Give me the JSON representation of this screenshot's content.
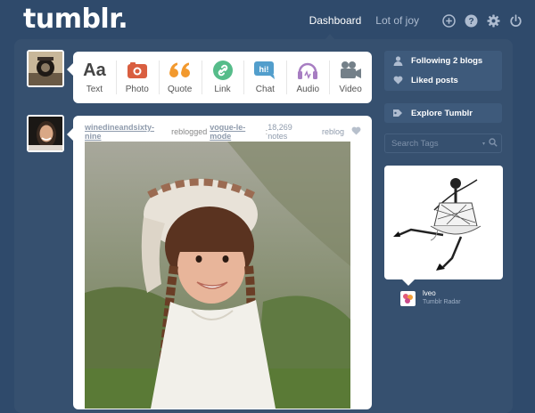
{
  "header": {
    "logo": "tumblr.",
    "nav": {
      "dashboard": "Dashboard",
      "blog": "Lot of joy"
    },
    "icons": [
      "plus-circle-icon",
      "help-icon",
      "gear-icon",
      "power-icon"
    ]
  },
  "post_types": [
    {
      "label": "Text",
      "icon": "text-icon",
      "color": "#444444"
    },
    {
      "label": "Photo",
      "icon": "camera-icon",
      "color": "#d95e40"
    },
    {
      "label": "Quote",
      "icon": "quote-icon",
      "color": "#f2992e"
    },
    {
      "label": "Link",
      "icon": "link-icon",
      "color": "#56bc8a"
    },
    {
      "label": "Chat",
      "icon": "chat-icon",
      "color": "#529ecc"
    },
    {
      "label": "Audio",
      "icon": "audio-icon",
      "color": "#a77dc2"
    },
    {
      "label": "Video",
      "icon": "video-icon",
      "color": "#748089"
    }
  ],
  "post": {
    "author": "winedineandsixty-nine",
    "action": "reblogged",
    "source": "vogue-le-mode",
    "colon": ":",
    "notes": "18,269 notes",
    "reblog": "reblog"
  },
  "sidebar": {
    "following": "Following 2 blogs",
    "liked": "Liked posts",
    "explore": "Explore Tumblr",
    "search_placeholder": "Search Tags"
  },
  "radar": {
    "user": "lveo",
    "label": "Tumblr Radar"
  },
  "colors": {
    "background": "#2f4a6b",
    "panel": "#36506f",
    "sidebar_button": "#3e5a7b"
  }
}
